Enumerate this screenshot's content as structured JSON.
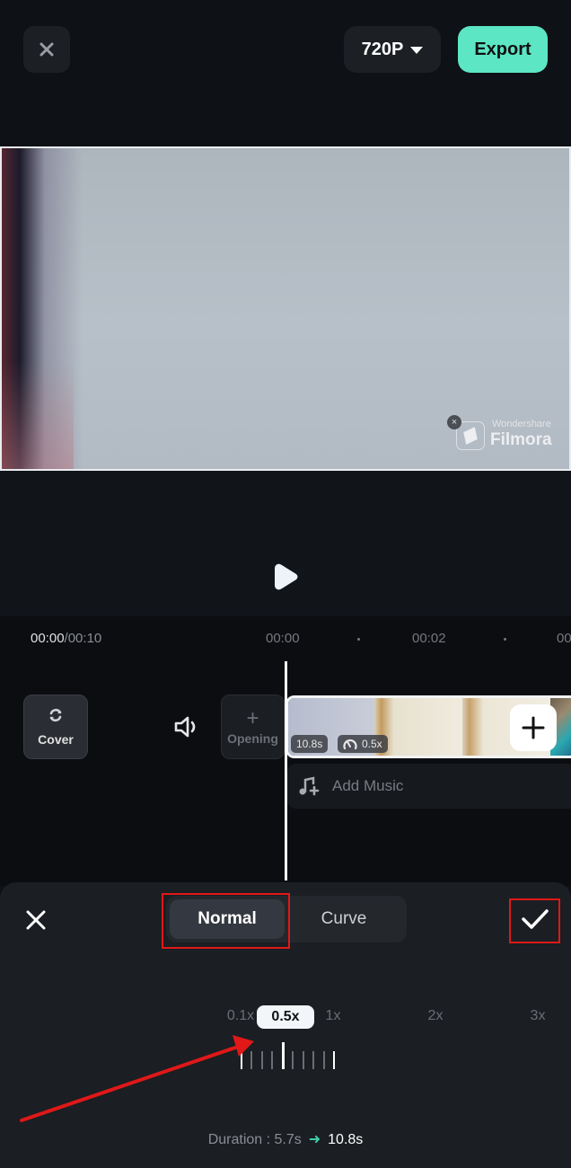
{
  "topbar": {
    "close_icon": "close-icon",
    "resolution_label": "720P",
    "resolution_icon": "caret-down-icon",
    "export_label": "Export",
    "export_color": "#5ce6c4"
  },
  "preview": {
    "watermark_brand_small": "Wondershare",
    "watermark_brand": "Filmora",
    "watermark_close_icon": "close-icon"
  },
  "player": {
    "play_icon": "play-icon"
  },
  "timeline": {
    "current_time": "00:00",
    "total_time": "/00:10",
    "ruler_labels": [
      "00:00",
      "00:02",
      "00"
    ],
    "cover_label": "Cover",
    "opening_label": "Opening",
    "opening_plus": "+",
    "clip_duration": "10.8s",
    "clip_speed": "0.5x",
    "add_music_label": "Add Music"
  },
  "speed_sheet": {
    "tabs": [
      {
        "label": "Normal",
        "selected": true
      },
      {
        "label": "Curve",
        "selected": false
      }
    ],
    "speed_marks": [
      "0.1x",
      "1x",
      "2x",
      "3x"
    ],
    "current_speed": "0.5x",
    "speed_value": 0.5,
    "speed_range": [
      0.1,
      3
    ],
    "duration_label": "Duration : 5.7s",
    "duration_new": "10.8s",
    "accent_color": "#3ecfa7"
  },
  "annotations": {
    "highlight_color": "#e01818"
  }
}
